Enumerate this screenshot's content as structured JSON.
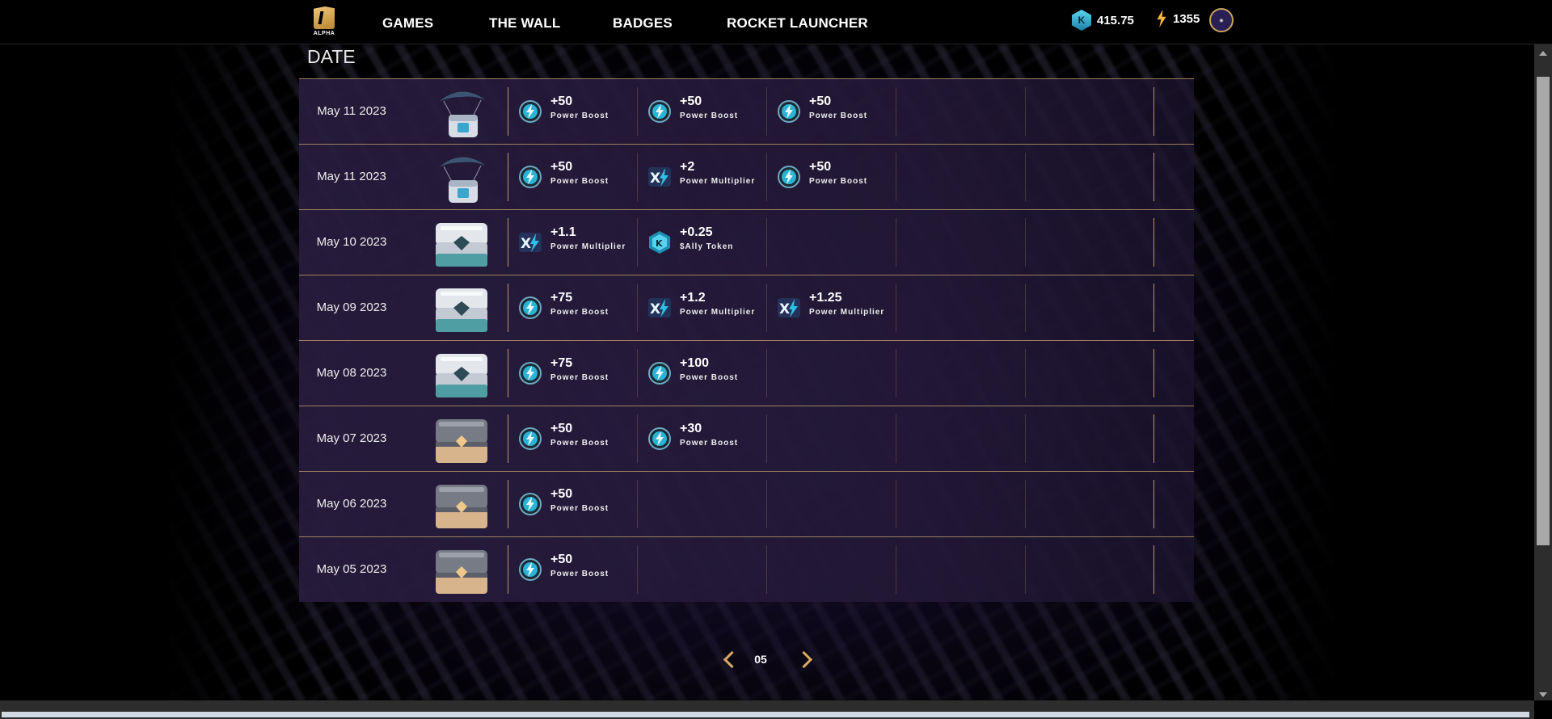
{
  "nav": {
    "logo_text": "ALPHA",
    "links": [
      "GAMES",
      "THE WALL",
      "BADGES",
      "ROCKET LAUNCHER"
    ],
    "token_balance": "415.75",
    "power_balance": "1355"
  },
  "table": {
    "header": "DATE",
    "rows": [
      {
        "date": "May 11 2023",
        "box": "parachute-crate",
        "rewards": [
          {
            "type": "boost",
            "amount": "+50",
            "label": "Power Boost"
          },
          {
            "type": "boost",
            "amount": "+50",
            "label": "Power Boost"
          },
          {
            "type": "boost",
            "amount": "+50",
            "label": "Power Boost"
          }
        ]
      },
      {
        "date": "May 11 2023",
        "box": "parachute-crate",
        "rewards": [
          {
            "type": "boost",
            "amount": "+50",
            "label": "Power Boost"
          },
          {
            "type": "multiplier",
            "amount": "+2",
            "label": "Power Multiplier"
          },
          {
            "type": "boost",
            "amount": "+50",
            "label": "Power Boost"
          }
        ]
      },
      {
        "date": "May 10 2023",
        "box": "silver-chest",
        "rewards": [
          {
            "type": "multiplier",
            "amount": "+1.1",
            "label": "Power Multiplier"
          },
          {
            "type": "token",
            "amount": "+0.25",
            "label": "$Ally Token"
          }
        ]
      },
      {
        "date": "May 09 2023",
        "box": "silver-chest",
        "rewards": [
          {
            "type": "boost",
            "amount": "+75",
            "label": "Power Boost"
          },
          {
            "type": "multiplier",
            "amount": "+1.2",
            "label": "Power Multiplier"
          },
          {
            "type": "multiplier",
            "amount": "+1.25",
            "label": "Power Multiplier"
          }
        ]
      },
      {
        "date": "May 08 2023",
        "box": "silver-chest",
        "rewards": [
          {
            "type": "boost",
            "amount": "+75",
            "label": "Power Boost"
          },
          {
            "type": "boost",
            "amount": "+100",
            "label": "Power Boost"
          }
        ]
      },
      {
        "date": "May 07 2023",
        "box": "bronze-chest",
        "rewards": [
          {
            "type": "boost",
            "amount": "+50",
            "label": "Power Boost"
          },
          {
            "type": "boost",
            "amount": "+30",
            "label": "Power Boost"
          }
        ]
      },
      {
        "date": "May 06 2023",
        "box": "bronze-chest",
        "rewards": [
          {
            "type": "boost",
            "amount": "+50",
            "label": "Power Boost"
          }
        ]
      },
      {
        "date": "May 05 2023",
        "box": "bronze-chest",
        "rewards": [
          {
            "type": "boost",
            "amount": "+50",
            "label": "Power Boost"
          }
        ]
      }
    ]
  },
  "pagination": {
    "current_page": "05"
  }
}
